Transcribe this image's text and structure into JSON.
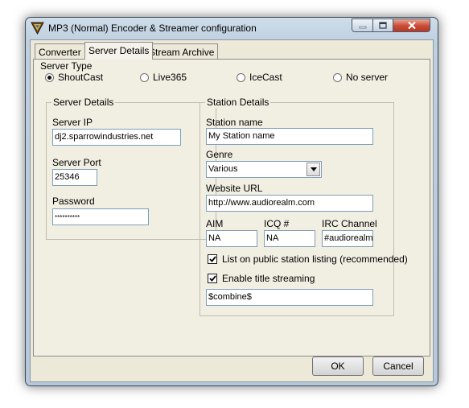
{
  "window": {
    "title": "MP3 (Normal) Encoder & Streamer configuration"
  },
  "tabs": [
    {
      "label": "Converter"
    },
    {
      "label": "Server Details",
      "active": true
    },
    {
      "label": "Stream Archive"
    }
  ],
  "server_type": {
    "label": "Server Type",
    "options": [
      {
        "label": "ShoutCast",
        "selected": true
      },
      {
        "label": "Live365",
        "selected": false
      },
      {
        "label": "IceCast",
        "selected": false
      },
      {
        "label": "No server",
        "selected": false
      }
    ]
  },
  "server_details": {
    "label": "Server Details",
    "ip_label": "Server IP",
    "ip_value": "dj2.sparrowindustries.net",
    "port_label": "Server Port",
    "port_value": "25346",
    "password_label": "Password",
    "password_value": "**********"
  },
  "station_details": {
    "label": "Station Details",
    "name_label": "Station name",
    "name_value": "My Station name",
    "genre_label": "Genre",
    "genre_value": "Various",
    "url_label": "Website URL",
    "url_value": "http://www.audiorealm.com",
    "aim_label": "AIM",
    "aim_value": "NA",
    "icq_label": "ICQ #",
    "icq_value": "NA",
    "irc_label": "IRC Channel",
    "irc_value": "#audiorealm",
    "list_public_label": "List on public station listing (recommended)",
    "list_public_checked": true,
    "title_streaming_label": "Enable title streaming",
    "title_streaming_checked": true,
    "title_format_value": "$combine$"
  },
  "buttons": {
    "ok_label": "OK",
    "cancel_label": "Cancel"
  },
  "colors": {
    "dialog_face": "#ece9d8",
    "tab_panel": "#f1efe2",
    "close_button": "#c94a34"
  }
}
